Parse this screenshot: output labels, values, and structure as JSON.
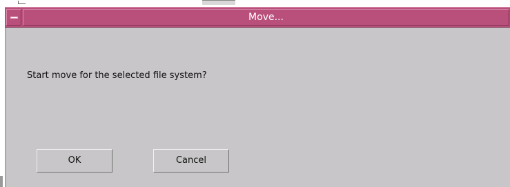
{
  "window": {
    "title": "Move...",
    "titlebar_color": "#b9507c",
    "background_color": "#c8c6c8"
  },
  "dialog": {
    "message": "Start move for the selected file system?",
    "buttons": {
      "ok_label": "OK",
      "cancel_label": "Cancel"
    }
  },
  "icons": {
    "window_menu": "window-menu-icon"
  }
}
